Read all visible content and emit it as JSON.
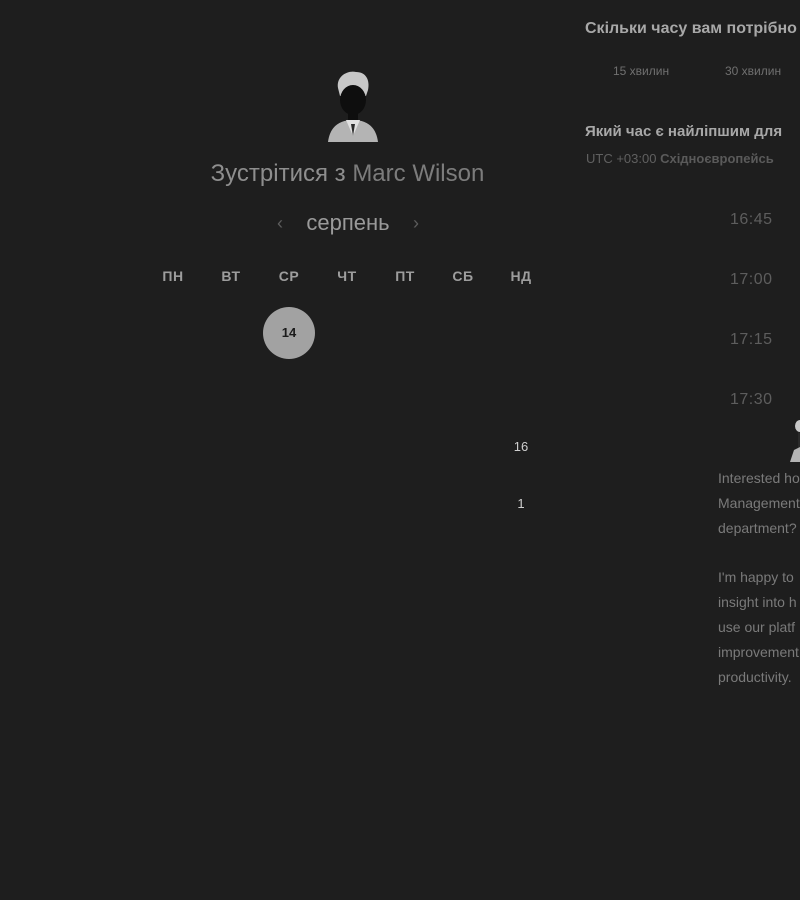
{
  "host": {
    "avatar_icon": "person-avatar-icon",
    "title_prefix": "Зустрітися з",
    "name": "Marc Wilson"
  },
  "calendar": {
    "month": "серпень",
    "prev_icon": "chevron-left-icon",
    "next_icon": "chevron-right-icon",
    "weekdays": [
      "ПН",
      "ВТ",
      "СР",
      "ЧТ",
      "ПТ",
      "СБ",
      "НД"
    ],
    "selected_day": "14",
    "weeks": [
      [
        "",
        "",
        "14",
        "",
        "",
        "",
        ""
      ],
      [
        "",
        "",
        "",
        "",
        "",
        "",
        ""
      ],
      [
        "",
        "",
        "",
        "",
        "",
        "",
        "16"
      ],
      [
        "",
        "",
        "",
        "",
        "",
        "",
        "1"
      ],
      [
        "",
        "",
        "",
        "",
        "",
        "",
        ""
      ],
      [
        "",
        "",
        "",
        "",
        "",
        "",
        ""
      ]
    ]
  },
  "duration": {
    "question": "Скільки часу вам потрібно",
    "options": [
      "15 хвилин",
      "30 хвилин"
    ]
  },
  "timeslots": {
    "question": "Який час є найліпшим для",
    "timezone_offset": "UTC +03:00",
    "timezone_name": "Східноєвропейсь",
    "slots": [
      "16:45",
      "17:00",
      "17:15",
      "17:30"
    ]
  },
  "intro": {
    "paragraph1": [
      "Interested ho",
      "Management",
      "department?"
    ],
    "paragraph2": [
      "I'm happy to",
      "insight into h",
      "use our platf",
      "improvement",
      "productivity."
    ]
  }
}
